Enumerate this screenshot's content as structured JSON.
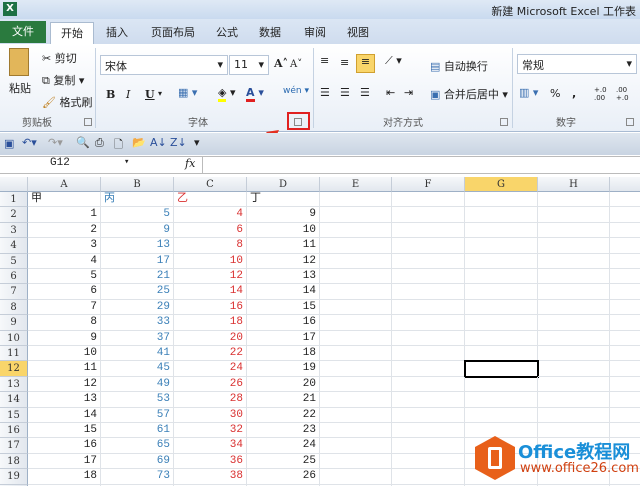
{
  "window": {
    "title": "新建 Microsoft Excel 工作表",
    "app_icon": "X"
  },
  "tabs": [
    "文件",
    "开始",
    "插入",
    "页面布局",
    "公式",
    "数据",
    "审阅",
    "视图"
  ],
  "clipboard": {
    "paste": "粘贴",
    "cut": "剪切",
    "copy": "复制",
    "format_painter": "格式刷",
    "group": "剪贴板"
  },
  "font": {
    "name": "宋体",
    "size": "11",
    "bold": "B",
    "italic": "I",
    "underline": "U",
    "grow": "A",
    "shrink": "A",
    "font_color": "A",
    "phonetic": "wén",
    "group": "字体"
  },
  "alignment": {
    "wrap": "自动换行",
    "merge": "合并后居中",
    "group": "对齐方式"
  },
  "number": {
    "format": "常规",
    "percent": "%",
    "comma": ",",
    "inc": "+.0 .00",
    "dec": ".00 +.0",
    "group": "数字"
  },
  "formula_bar": {
    "name_box": "G12",
    "fx": "fx",
    "value": ""
  },
  "columns": [
    "A",
    "B",
    "C",
    "D",
    "E",
    "F",
    "G",
    "H"
  ],
  "header_row": [
    "甲",
    "丙",
    "乙",
    "丁"
  ],
  "rows": [
    [
      1,
      5,
      4,
      9
    ],
    [
      2,
      9,
      6,
      10
    ],
    [
      3,
      13,
      8,
      11
    ],
    [
      4,
      17,
      10,
      12
    ],
    [
      5,
      21,
      12,
      13
    ],
    [
      6,
      25,
      14,
      14
    ],
    [
      7,
      29,
      16,
      15
    ],
    [
      8,
      33,
      18,
      16
    ],
    [
      9,
      37,
      20,
      17
    ],
    [
      10,
      41,
      22,
      18
    ],
    [
      11,
      45,
      24,
      19
    ],
    [
      12,
      49,
      26,
      20
    ],
    [
      13,
      53,
      28,
      21
    ],
    [
      14,
      57,
      30,
      22
    ],
    [
      15,
      61,
      32,
      23
    ],
    [
      16,
      65,
      34,
      24
    ],
    [
      17,
      69,
      36,
      25
    ],
    [
      18,
      73,
      38,
      26
    ]
  ],
  "selected_cell": "G12",
  "watermark": {
    "brand": "Office教程网",
    "url": "www.office26.com"
  },
  "colors": {
    "file_tab": "#2a7a3e",
    "blue": "#3a7fb7",
    "red": "#d93030",
    "highlight": "#f9d56a"
  }
}
